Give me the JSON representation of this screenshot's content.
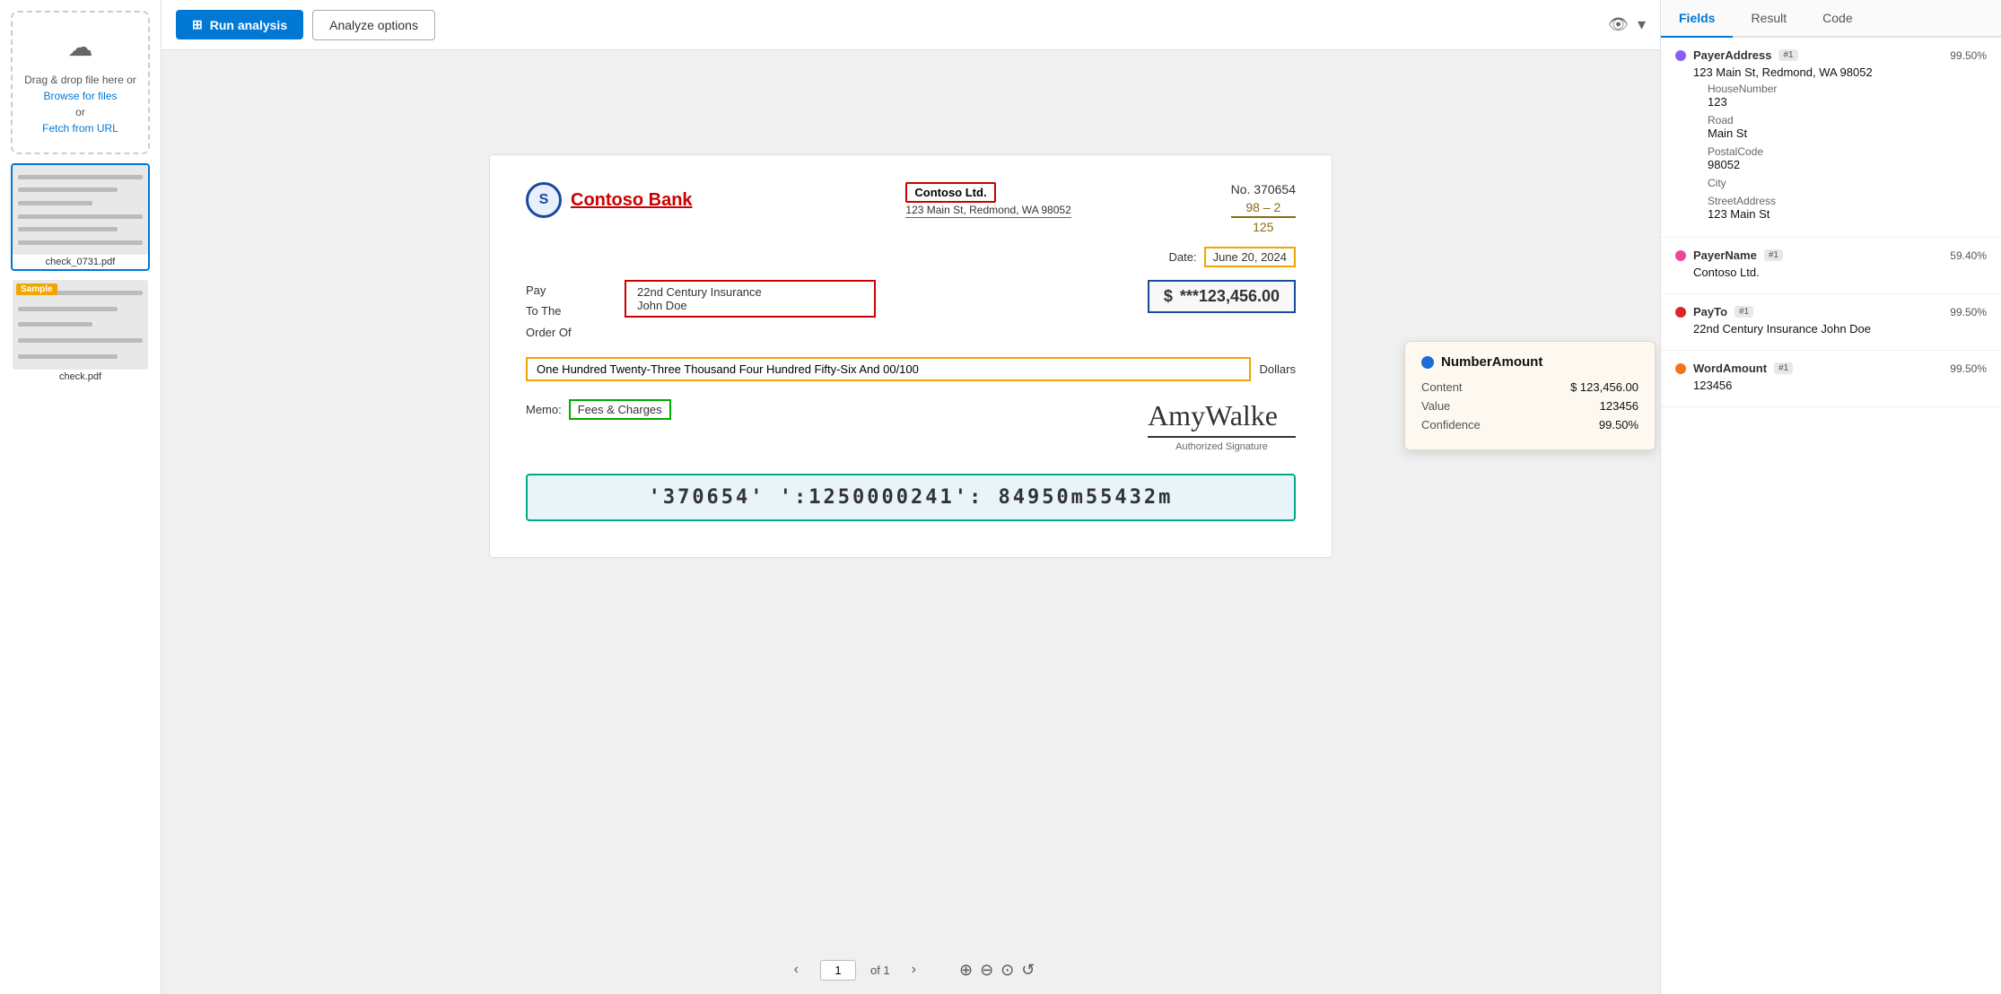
{
  "sidebar": {
    "drop_zone": {
      "icon": "☁",
      "text1": "Drag & drop file here or",
      "browse_label": "Browse for files",
      "or_text": "or",
      "fetch_label": "Fetch from URL"
    },
    "files": [
      {
        "name": "check_0731.pdf",
        "selected": true,
        "has_badge": false
      },
      {
        "name": "check.pdf",
        "selected": false,
        "has_badge": true,
        "badge_text": "Sample"
      }
    ]
  },
  "toolbar": {
    "run_label": "Run analysis",
    "analyze_label": "Analyze options"
  },
  "check": {
    "bank_name": "Contoso Bank",
    "logo_text": "S",
    "check_no": "No. 370654",
    "fraction_top": "98 – 2",
    "fraction_bottom": "125",
    "payer_name": "Contoso Ltd.",
    "payer_address": "123 Main St, Redmond, WA 98052",
    "date_label": "Date:",
    "date_value": "June 20, 2024",
    "payto_label1": "Pay",
    "payto_label2": "To The",
    "payto_label3": "Order Of",
    "payto_line1": "22nd Century Insurance",
    "payto_line2": "John Doe",
    "amount_symbol": "$",
    "amount_value": "***123,456.00",
    "word_amount": "One Hundred Twenty-Three Thousand Four Hundred Fifty-Six And 00/100",
    "dollars_label": "Dollars",
    "memo_label": "Memo:",
    "memo_value": "Fees & Charges",
    "signature_text": "AmyWalke",
    "signature_label": "Authorized Signature",
    "micr": "'370654'  ':1250000241':  84950m55432m"
  },
  "pagination": {
    "prev_icon": "‹",
    "next_icon": "›",
    "current_page": "1",
    "total_label": "of 1"
  },
  "right_panel": {
    "tabs": [
      {
        "label": "Fields",
        "active": true
      },
      {
        "label": "Result",
        "active": false
      },
      {
        "label": "Code",
        "active": false
      }
    ],
    "fields": [
      {
        "dot_color": "#8b5cf6",
        "name": "PayerAddress",
        "badge": "#1",
        "confidence": "99.50%",
        "value": "123 Main St, Redmond, WA 98052",
        "sub_fields": [
          {
            "label": "HouseNumber",
            "value": "123"
          },
          {
            "label": "Road",
            "value": "Main St"
          },
          {
            "label": "PostalCode",
            "value": "98052"
          },
          {
            "label": "City",
            "value": ""
          },
          {
            "label": "StreetAddress",
            "value": "123 Main St"
          }
        ]
      },
      {
        "dot_color": "#ec4899",
        "name": "PayerName",
        "badge": "#1",
        "confidence": "59.40%",
        "value": "Contoso Ltd.",
        "sub_fields": []
      },
      {
        "dot_color": "#dc2626",
        "name": "PayTo",
        "badge": "#1",
        "confidence": "99.50%",
        "value": "22nd Century Insurance John Doe",
        "sub_fields": []
      },
      {
        "dot_color": "#f97316",
        "name": "WordAmount",
        "badge": "#1",
        "confidence": "99.50%",
        "value": "123456",
        "sub_fields": []
      }
    ]
  },
  "tooltip": {
    "dot_color": "#1a6dd4",
    "title": "NumberAmount",
    "content_label": "Content",
    "content_value": "$ 123,456.00",
    "value_label": "Value",
    "value_value": "123456",
    "confidence_label": "Confidence",
    "confidence_value": "99.50%"
  }
}
